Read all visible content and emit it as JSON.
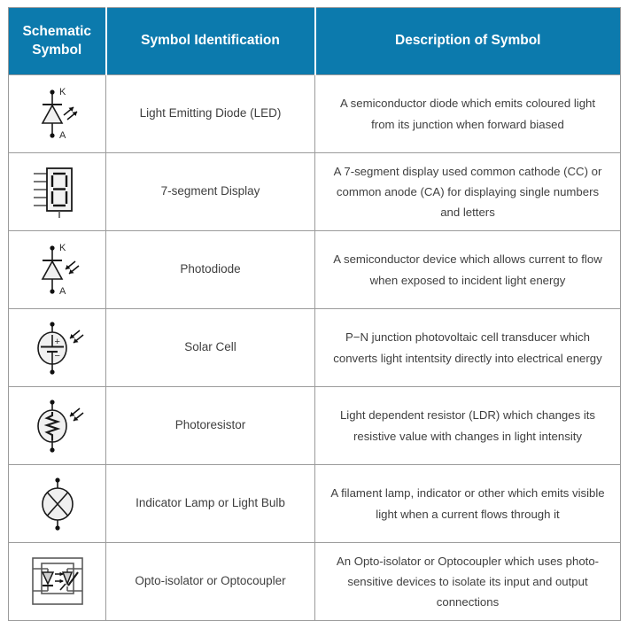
{
  "table": {
    "headers": [
      {
        "label": "Schematic Symbol",
        "name": "header-schematic-symbol"
      },
      {
        "label": "Symbol Identification",
        "name": "header-symbol-identification"
      },
      {
        "label": "Description of Symbol",
        "name": "header-description-of-symbol"
      }
    ],
    "accent_color": "#0c7aad",
    "header_text_color": "#ffffff",
    "border_color": "#9b9b9b",
    "body_text_color": "#3f3f3f",
    "rows": [
      {
        "symbol": "led-symbol",
        "symbol_labels": {
          "top": "K",
          "bottom": "A"
        },
        "identification": "Light Emitting Diode (LED)",
        "description": "A semiconductor diode which emits coloured light from its junction when forward biased"
      },
      {
        "symbol": "seven-segment-display-symbol",
        "symbol_labels": {},
        "identification": "7-segment Display",
        "description": "A 7-segment display used common cathode (CC) or common anode (CA) for displaying single numbers and letters"
      },
      {
        "symbol": "photodiode-symbol",
        "symbol_labels": {
          "top": "K",
          "bottom": "A"
        },
        "identification": "Photodiode",
        "description": "A semiconductor device which allows current to flow when exposed to incident light energy"
      },
      {
        "symbol": "solar-cell-symbol",
        "symbol_labels": {
          "plus": "+",
          "minus": "−"
        },
        "identification": "Solar Cell",
        "description": "P−N junction photovoltaic cell transducer which converts light intentsity directly into electrical energy"
      },
      {
        "symbol": "photoresistor-symbol",
        "symbol_labels": {},
        "identification": "Photoresistor",
        "description": "Light dependent resistor (LDR) which changes its resistive value with changes in light intensity"
      },
      {
        "symbol": "indicator-lamp-symbol",
        "symbol_labels": {},
        "identification": "Indicator Lamp or Light Bulb",
        "description": "A filament lamp, indicator or other which emits visible light when a current flows through it"
      },
      {
        "symbol": "opto-isolator-symbol",
        "symbol_labels": {},
        "identification": "Opto-isolator or Optocoupler",
        "description": "An Opto-isolator or Optocoupler which uses photo-sensitive devices to isolate its input and output connections"
      }
    ]
  }
}
